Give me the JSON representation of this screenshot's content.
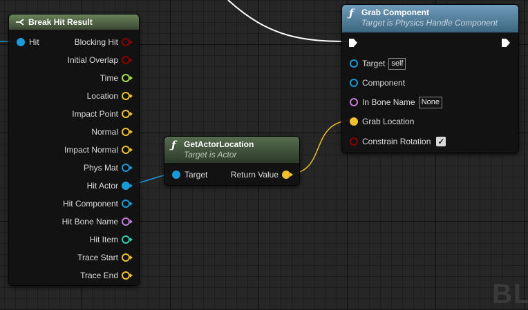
{
  "break_node": {
    "title": "Break Hit Result",
    "input": "Hit",
    "outputs": [
      {
        "label": "Blocking Hit",
        "color": "#8b0000"
      },
      {
        "label": "Initial Overlap",
        "color": "#8b0000"
      },
      {
        "label": "Time",
        "color": "#a7e34a"
      },
      {
        "label": "Location",
        "color": "#f0c030"
      },
      {
        "label": "Impact Point",
        "color": "#f0c030"
      },
      {
        "label": "Normal",
        "color": "#f0c030"
      },
      {
        "label": "Impact Normal",
        "color": "#f0c030"
      },
      {
        "label": "Phys Mat",
        "color": "#1a9ad6"
      },
      {
        "label": "Hit Actor",
        "color": "#1a9ad6"
      },
      {
        "label": "Hit Component",
        "color": "#1a9ad6"
      },
      {
        "label": "Hit Bone Name",
        "color": "#c07ee0"
      },
      {
        "label": "Hit Item",
        "color": "#2fd0a8"
      },
      {
        "label": "Trace Start",
        "color": "#f0c030"
      },
      {
        "label": "Trace End",
        "color": "#f0c030"
      }
    ]
  },
  "get_node": {
    "title": "GetActorLocation",
    "subtitle": "Target is Actor",
    "input": "Target",
    "output": "Return Value"
  },
  "grab_node": {
    "title": "Grab Component",
    "subtitle": "Target is Physics Handle Component",
    "inputs": [
      {
        "label": "Target",
        "value": "self",
        "color": "#1a9ad6"
      },
      {
        "label": "Component",
        "color": "#1a9ad6"
      },
      {
        "label": "In Bone Name",
        "value": "None",
        "color": "#c07ee0"
      },
      {
        "label": "Grab Location",
        "color": "#f0c030"
      },
      {
        "label": "Constrain Rotation",
        "color": "#8b0000"
      }
    ]
  },
  "watermark": "BL"
}
